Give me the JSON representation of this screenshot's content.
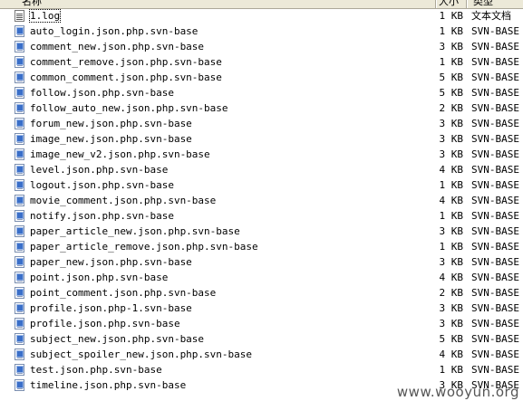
{
  "header": {
    "name": "名称",
    "size": "大小",
    "type": "类型"
  },
  "files": [
    {
      "name": "1.log",
      "size": "1 KB",
      "type": "文本文档",
      "icon": "text-file-icon"
    },
    {
      "name": "auto_login.json.php.svn-base",
      "size": "1 KB",
      "type": "SVN-BASE 文",
      "icon": "svn-file-icon"
    },
    {
      "name": "comment_new.json.php.svn-base",
      "size": "3 KB",
      "type": "SVN-BASE 文",
      "icon": "svn-file-icon"
    },
    {
      "name": "comment_remove.json.php.svn-base",
      "size": "1 KB",
      "type": "SVN-BASE 文",
      "icon": "svn-file-icon"
    },
    {
      "name": "common_comment.json.php.svn-base",
      "size": "5 KB",
      "type": "SVN-BASE 文",
      "icon": "svn-file-icon"
    },
    {
      "name": "follow.json.php.svn-base",
      "size": "5 KB",
      "type": "SVN-BASE 文",
      "icon": "svn-file-icon"
    },
    {
      "name": "follow_auto_new.json.php.svn-base",
      "size": "2 KB",
      "type": "SVN-BASE 文",
      "icon": "svn-file-icon"
    },
    {
      "name": "forum_new.json.php.svn-base",
      "size": "3 KB",
      "type": "SVN-BASE 文",
      "icon": "svn-file-icon"
    },
    {
      "name": "image_new.json.php.svn-base",
      "size": "3 KB",
      "type": "SVN-BASE 文",
      "icon": "svn-file-icon"
    },
    {
      "name": "image_new_v2.json.php.svn-base",
      "size": "3 KB",
      "type": "SVN-BASE 文",
      "icon": "svn-file-icon"
    },
    {
      "name": "level.json.php.svn-base",
      "size": "4 KB",
      "type": "SVN-BASE 文",
      "icon": "svn-file-icon"
    },
    {
      "name": "logout.json.php.svn-base",
      "size": "1 KB",
      "type": "SVN-BASE 文",
      "icon": "svn-file-icon"
    },
    {
      "name": "movie_comment.json.php.svn-base",
      "size": "4 KB",
      "type": "SVN-BASE 文",
      "icon": "svn-file-icon"
    },
    {
      "name": "notify.json.php.svn-base",
      "size": "1 KB",
      "type": "SVN-BASE 文",
      "icon": "svn-file-icon"
    },
    {
      "name": "paper_article_new.json.php.svn-base",
      "size": "3 KB",
      "type": "SVN-BASE 文",
      "icon": "svn-file-icon"
    },
    {
      "name": "paper_article_remove.json.php.svn-base",
      "size": "1 KB",
      "type": "SVN-BASE 文",
      "icon": "svn-file-icon"
    },
    {
      "name": "paper_new.json.php.svn-base",
      "size": "3 KB",
      "type": "SVN-BASE 文",
      "icon": "svn-file-icon"
    },
    {
      "name": "point.json.php.svn-base",
      "size": "4 KB",
      "type": "SVN-BASE 文",
      "icon": "svn-file-icon"
    },
    {
      "name": "point_comment.json.php.svn-base",
      "size": "2 KB",
      "type": "SVN-BASE 文",
      "icon": "svn-file-icon"
    },
    {
      "name": "profile.json.php-1.svn-base",
      "size": "3 KB",
      "type": "SVN-BASE 文",
      "icon": "svn-file-icon"
    },
    {
      "name": "profile.json.php.svn-base",
      "size": "3 KB",
      "type": "SVN-BASE 文",
      "icon": "svn-file-icon"
    },
    {
      "name": "subject_new.json.php.svn-base",
      "size": "5 KB",
      "type": "SVN-BASE 文",
      "icon": "svn-file-icon"
    },
    {
      "name": "subject_spoiler_new.json.php.svn-base",
      "size": "4 KB",
      "type": "SVN-BASE 文",
      "icon": "svn-file-icon"
    },
    {
      "name": "test.json.php.svn-base",
      "size": "1 KB",
      "type": "SVN-BASE 文",
      "icon": "svn-file-icon"
    },
    {
      "name": "timeline.json.php.svn-base",
      "size": "3 KB",
      "type": "SVN-BASE 文",
      "icon": "svn-file-icon"
    }
  ],
  "watermark": "www.wooyun.org"
}
